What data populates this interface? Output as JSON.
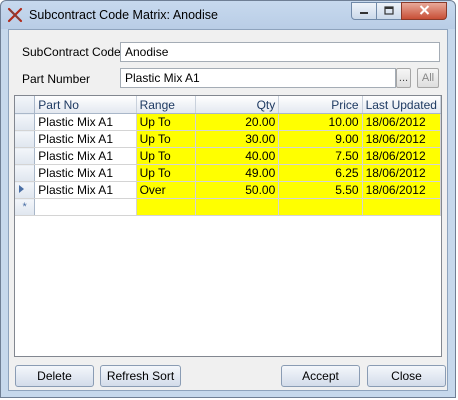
{
  "window": {
    "title": "Subcontract Code Matrix: Anodise"
  },
  "form": {
    "subcontract_code_label": "SubContract Code",
    "subcontract_code_value": "Anodise",
    "part_number_label": "Part Number",
    "part_number_value": "Plastic Mix A1",
    "browse_label": "...",
    "all_label": "All"
  },
  "grid": {
    "columns": {
      "part_no": "Part No",
      "range": "Range",
      "qty": "Qty",
      "price": "Price",
      "last_updated": "Last Updated"
    },
    "rows": [
      {
        "part_no": "Plastic Mix A1",
        "range": "Up To",
        "qty": "20.00",
        "price": "10.00",
        "last_updated": "18/06/2012"
      },
      {
        "part_no": "Plastic Mix A1",
        "range": "Up To",
        "qty": "30.00",
        "price": "9.00",
        "last_updated": "18/06/2012"
      },
      {
        "part_no": "Plastic Mix A1",
        "range": "Up To",
        "qty": "40.00",
        "price": "7.50",
        "last_updated": "18/06/2012"
      },
      {
        "part_no": "Plastic Mix A1",
        "range": "Up To",
        "qty": "49.00",
        "price": "6.25",
        "last_updated": "18/06/2012"
      },
      {
        "part_no": "Plastic Mix A1",
        "range": "Over",
        "qty": "50.00",
        "price": "5.50",
        "last_updated": "18/06/2012"
      }
    ],
    "new_row_marker": "*",
    "highlight_color": "#ffff00"
  },
  "buttons": {
    "delete": "Delete",
    "refresh_sort": "Refresh Sort",
    "accept": "Accept",
    "close": "Close"
  },
  "icons": {
    "app": "crossed-tools-icon",
    "minimize": "minimize-icon",
    "maximize": "maximize-icon",
    "close": "close-icon",
    "current_row": "row-pointer-icon"
  }
}
